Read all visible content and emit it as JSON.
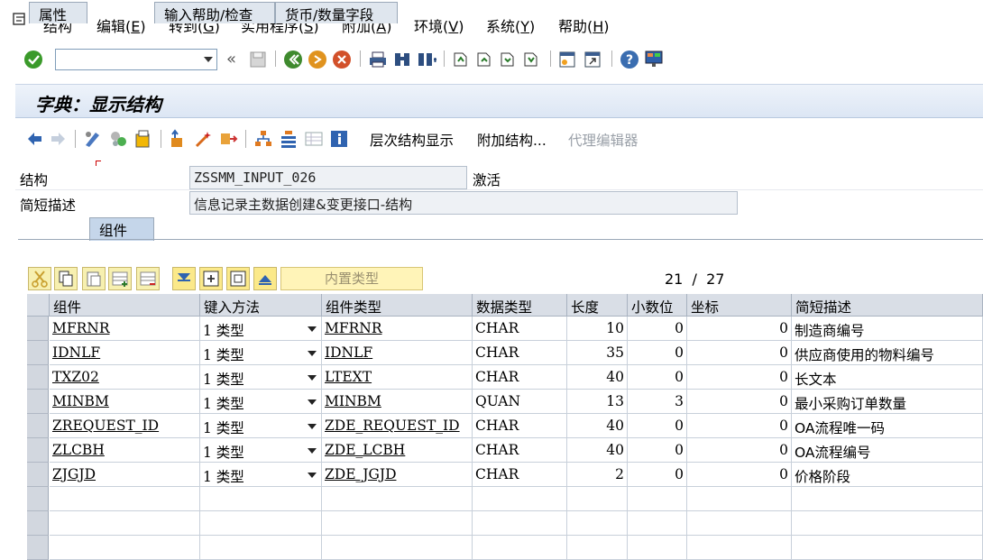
{
  "menu": [
    {
      "text": "结构",
      "mn": ""
    },
    {
      "text": "编辑(",
      "mn": "E",
      "end": ")"
    },
    {
      "text": "转到(",
      "mn": "G",
      "end": ")"
    },
    {
      "text": "实用程序(",
      "mn": "S",
      "end": ")"
    },
    {
      "text": "附加(",
      "mn": "A",
      "end": ")"
    },
    {
      "text": "环境(",
      "mn": "V",
      "end": ")"
    },
    {
      "text": "系统(",
      "mn": "Y",
      "end": ")"
    },
    {
      "text": "帮助(",
      "mn": "H",
      "end": ")"
    }
  ],
  "command_field": {
    "value": ""
  },
  "title": "字典：显示结构",
  "app_toolbar": {
    "hier_display": "层次结构显示",
    "append_struct": "附加结构...",
    "proxy_editor": "代理编辑器"
  },
  "header": {
    "struct_label": "结构",
    "struct_value": "ZSSMM_INPUT_026",
    "status": "激活",
    "desc_label": "简短描述",
    "desc_value": "信息记录主数据创建&变更接口-结构"
  },
  "tabs": [
    "属性",
    "组件",
    "输入帮助/检查",
    "货币/数量字段"
  ],
  "active_tab": 1,
  "table_toolbar": {
    "builtin_type": "内置类型"
  },
  "pager": {
    "current": "21",
    "sep": "/",
    "total": "27"
  },
  "columns": [
    "组件",
    "键入方法",
    "组件类型",
    "数据类型",
    "长度",
    "小数位",
    "坐标",
    "简短描述"
  ],
  "rows": [
    {
      "comp": "MFRNR",
      "method": "1 类型",
      "ctype": "MFRNR",
      "dtype": "CHAR",
      "len": "10",
      "dec": "0",
      "coord": "0",
      "desc": "制造商编号"
    },
    {
      "comp": "IDNLF",
      "method": "1 类型",
      "ctype": "IDNLF",
      "dtype": "CHAR",
      "len": "35",
      "dec": "0",
      "coord": "0",
      "desc": "供应商使用的物料编号"
    },
    {
      "comp": "TXZ02",
      "method": "1 类型",
      "ctype": "LTEXT",
      "dtype": "CHAR",
      "len": "40",
      "dec": "0",
      "coord": "0",
      "desc": "长文本"
    },
    {
      "comp": "MINBM",
      "method": "1 类型",
      "ctype": "MINBM",
      "dtype": "QUAN",
      "len": "13",
      "dec": "3",
      "coord": "0",
      "desc": "最小采购订单数量"
    },
    {
      "comp": "ZREQUEST_ID",
      "method": "1 类型",
      "ctype": "ZDE_REQUEST_ID",
      "dtype": "CHAR",
      "len": "40",
      "dec": "0",
      "coord": "0",
      "desc": "OA流程唯一码"
    },
    {
      "comp": "ZLCBH",
      "method": "1 类型",
      "ctype": "ZDE_LCBH",
      "dtype": "CHAR",
      "len": "40",
      "dec": "0",
      "coord": "0",
      "desc": "OA流程编号"
    },
    {
      "comp": "ZJGJD",
      "method": "1 类型",
      "ctype": "ZDE_JGJD",
      "dtype": "CHAR",
      "len": "2",
      "dec": "0",
      "coord": "0",
      "desc": "价格阶段"
    }
  ]
}
